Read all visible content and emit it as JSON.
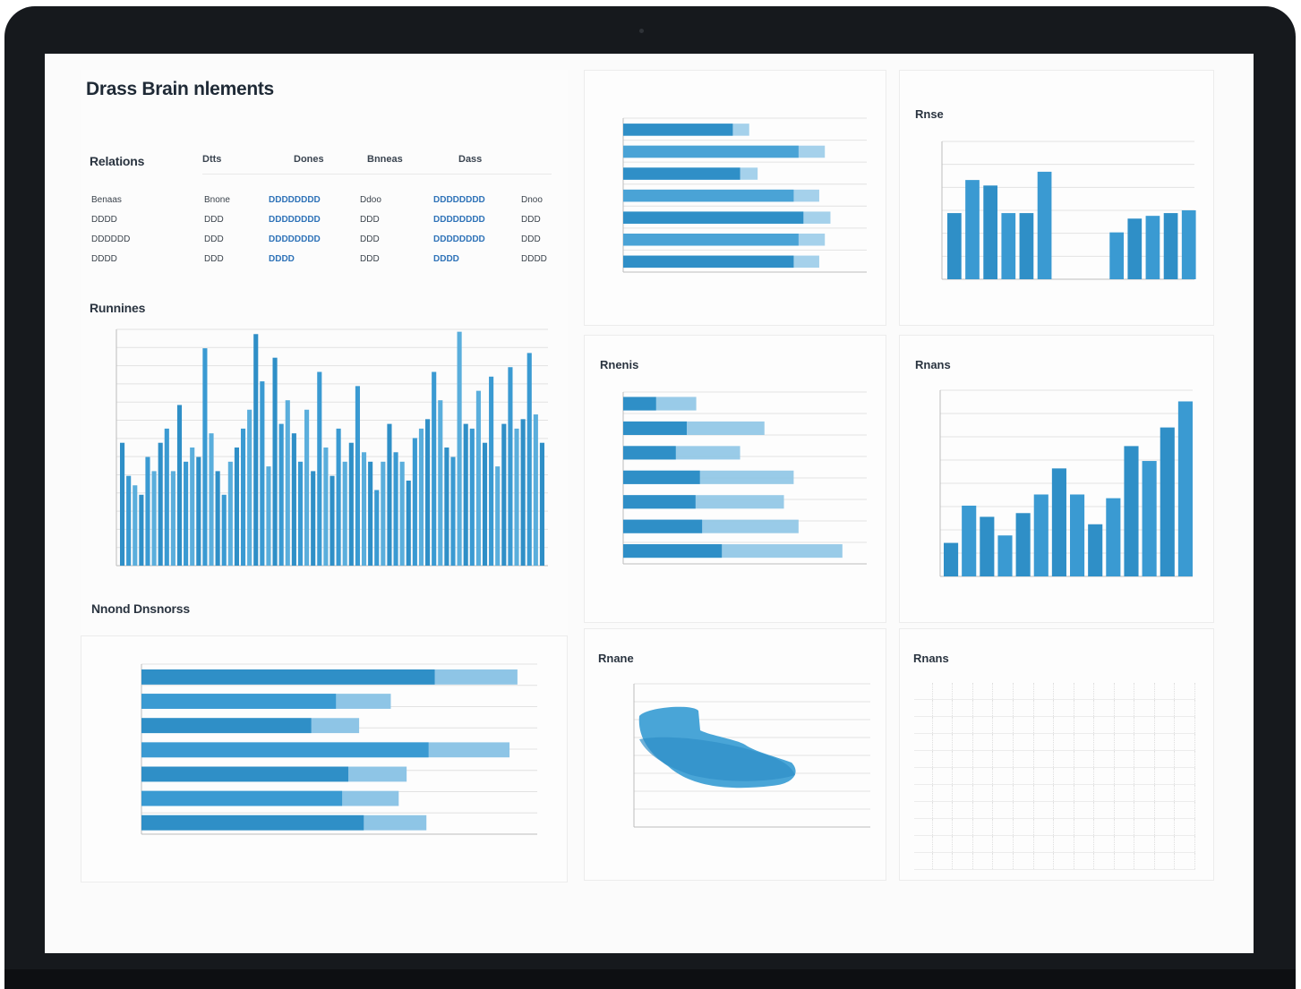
{
  "dashboard": {
    "title": "Drass Brain nlements"
  },
  "left": {
    "stats_title": "Relations",
    "stats_headers": [
      "",
      "Dtts",
      "Dones",
      "Bnneas",
      "Dass"
    ],
    "stats_rows": [
      [
        "Benaas",
        "Bnone",
        "DDDDDDDD",
        "Ddoo",
        "DDDDDDDD",
        "Dnoo"
      ],
      [
        "DDDD",
        "DDD",
        "DDDDDDDD",
        "DDD",
        "DDDDDDDD",
        "DDD"
      ],
      [
        "DDDDDD",
        "DDD",
        "DDDDDDDD",
        "DDD",
        "DDDDDDDD",
        "DDD"
      ],
      [
        "DDDD",
        "DDD",
        "DDDD",
        "DDD",
        "DDDD",
        "DDDD"
      ]
    ],
    "bars_title": "Runnines",
    "hbars_title": "Nnond Dnsnorss"
  },
  "panels": {
    "p1_title": "",
    "p2_title": "Rnse",
    "p3_title": "Rnenis",
    "p4_title": "Rnans",
    "p5_title": "Rnane",
    "p6_title": "Rnans"
  },
  "colors": {
    "accent": "#2f8fc7",
    "accent_light": "#8ec5e6",
    "bezel": "#16191d",
    "screen": "#fbfbfb"
  },
  "chart_data": [
    {
      "id": "main-columns",
      "type": "bar",
      "values": [
        52,
        38,
        34,
        30,
        46,
        40,
        52,
        58,
        40,
        68,
        44,
        50,
        46,
        92,
        56,
        40,
        30,
        44,
        50,
        58,
        66,
        98,
        78,
        42,
        88,
        60,
        70,
        56,
        44,
        66,
        40,
        82,
        50,
        38,
        58,
        44,
        52,
        76,
        48,
        44,
        32,
        44,
        60,
        48,
        44,
        36,
        54,
        58,
        62,
        82,
        70,
        50,
        46,
        99,
        60,
        58,
        74,
        52,
        80,
        42,
        60,
        84,
        58,
        62,
        90,
        64,
        52
      ],
      "ylim": [
        0,
        100
      ],
      "grid": true
    },
    {
      "id": "top-hbars",
      "type": "bar",
      "orientation": "horizontal",
      "values": [
        45,
        72,
        48,
        70,
        74,
        72,
        70
      ],
      "secondary": [
        50,
        72,
        48,
        70,
        74,
        72,
        70
      ],
      "xlim": [
        0,
        100
      ],
      "grid": true
    },
    {
      "id": "top-right-columns",
      "type": "bar",
      "values": [
        48,
        72,
        68,
        48,
        48,
        78,
        0,
        0,
        0,
        34,
        44,
        46,
        48,
        50
      ],
      "ylim": [
        0,
        100
      ],
      "grid": true
    },
    {
      "id": "mid-hbars",
      "type": "bar",
      "orientation": "horizontal",
      "values": [
        30,
        58,
        48,
        70,
        66,
        72,
        90
      ],
      "xlim": [
        0,
        100
      ],
      "grid": true
    },
    {
      "id": "mid-right-columns",
      "type": "bar",
      "values": [
        18,
        38,
        32,
        22,
        34,
        44,
        58,
        44,
        28,
        42,
        70,
        62,
        80,
        94
      ],
      "ylim": [
        0,
        100
      ],
      "grid": true
    },
    {
      "id": "bottom-hbars",
      "type": "bar",
      "orientation": "horizontal",
      "values": [
        95,
        63,
        55,
        93,
        67,
        65,
        72
      ],
      "xlim": [
        0,
        100
      ],
      "grid": true
    },
    {
      "id": "area-blob",
      "type": "area",
      "grid": true
    }
  ]
}
